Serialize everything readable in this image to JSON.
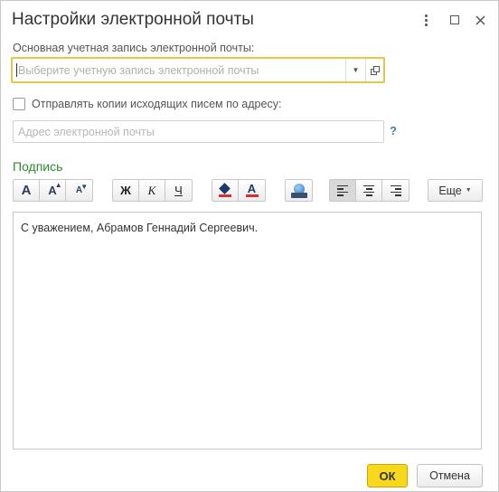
{
  "window": {
    "title": "Настройки электронной почты"
  },
  "account": {
    "label": "Основная учетная запись электронной почты:",
    "placeholder": "Выберите учетную запись электронной почты",
    "value": ""
  },
  "copies": {
    "checkbox_label": "Отправлять копии исходящих писем по адресу:",
    "checked": false,
    "address_placeholder": "Адрес электронной почты",
    "help_label": "?"
  },
  "signature": {
    "section_title": "Подпись",
    "toolbar": {
      "font_larger": "A",
      "font_increase": "A",
      "font_decrease": "A",
      "bold": "Ж",
      "italic": "К",
      "underline": "Ч",
      "text_color": "A",
      "more_label": "Еще"
    },
    "text": "С уважением, Абрамов Геннадий Сергеевич."
  },
  "footer": {
    "ok_label": "ОК",
    "cancel_label": "Отмена"
  },
  "colors": {
    "accent_yellow": "#f7d81c",
    "section_green": "#2e8b2e",
    "help_blue": "#3d7fba",
    "focus_border": "#e2c84a"
  },
  "icons": [
    "more-vert-icon",
    "maximize-icon",
    "close-icon",
    "dropdown-icon",
    "open-icon",
    "fill-color-icon",
    "text-color-icon",
    "insert-image-icon",
    "align-left-icon",
    "align-center-icon",
    "align-right-icon"
  ]
}
